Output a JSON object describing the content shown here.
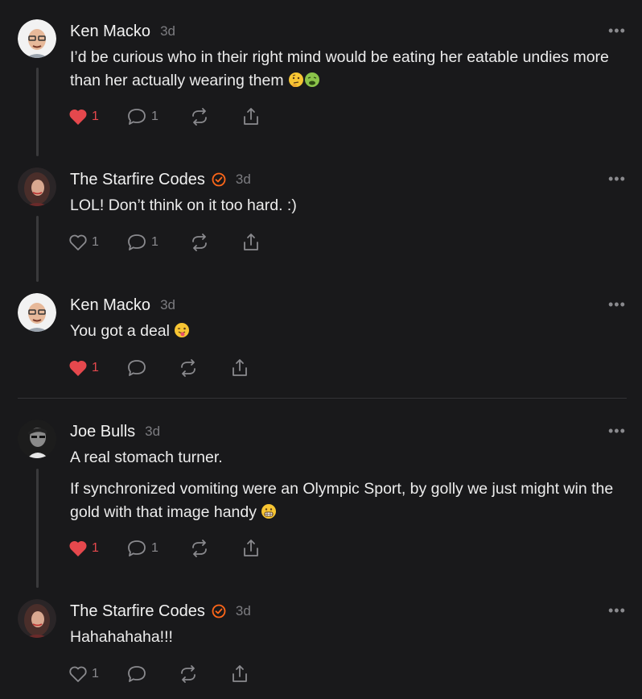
{
  "comments": [
    {
      "author": "Ken Macko",
      "time": "3d",
      "verified": false,
      "paragraphs": [
        "I’d be curious who in their right mind would be eating her eatable undies more than her actually wearing them"
      ],
      "emojis": [
        "thinking-face",
        "nauseated-face"
      ],
      "likes": "1",
      "liked": true,
      "replies": "1"
    },
    {
      "author": "The Starfire Codes",
      "time": "3d",
      "verified": true,
      "paragraphs": [
        "LOL! Don’t think on it too hard. :)"
      ],
      "likes": "1",
      "liked": false,
      "replies": "1"
    },
    {
      "author": "Ken Macko",
      "time": "3d",
      "verified": false,
      "paragraphs": [
        "You got a deal"
      ],
      "emojis": [
        "winking-tongue-face"
      ],
      "likes": "1",
      "liked": true,
      "replies": ""
    },
    {
      "author": "Joe Bulls",
      "time": "3d",
      "verified": false,
      "paragraphs": [
        "A real stomach turner.",
        "If synchronized vomiting were an Olympic Sport, by golly we just might win the gold with that image handy"
      ],
      "emojis": [
        "grimacing-face"
      ],
      "likes": "1",
      "liked": true,
      "replies": "1"
    },
    {
      "author": "The Starfire Codes",
      "time": "3d",
      "verified": true,
      "paragraphs": [
        "Hahahahaha!!!"
      ],
      "likes": "1",
      "liked": false,
      "replies": ""
    }
  ],
  "more_label": "•••",
  "colors": {
    "like": "#e5484d",
    "verified": "#ff6719",
    "background": "#19191b"
  }
}
